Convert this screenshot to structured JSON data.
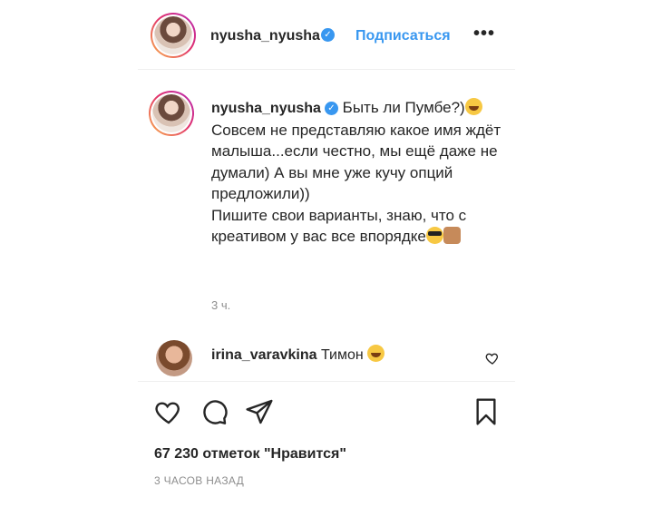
{
  "header": {
    "username": "nyusha_nyusha",
    "verified_mark": "✓",
    "follow_label": "Подписаться",
    "more_label": "•••"
  },
  "caption": {
    "username": "nyusha_nyusha",
    "verified_mark": "✓",
    "line1": "Быть ли Пумбе?)",
    "line2": "Совсем не представляю какое имя ждёт малыша...если честно, мы ещё даже не думали) А вы мне уже кучу опций предложили))",
    "line3": "Пишите свои варианты, знаю, что с креативом у вас все впорядке",
    "time": "3 ч."
  },
  "comment": {
    "username": "irina_varavkina",
    "text": "Тимон"
  },
  "footer": {
    "likes": "67 230 отметок \"Нравится\"",
    "ago": "3 ЧАСОВ НАЗАД"
  },
  "icons": [
    "heart-icon",
    "comment-icon",
    "share-icon",
    "bookmark-icon",
    "more-icon",
    "verified-badge-icon"
  ],
  "colors": {
    "link": "#3897f0",
    "text": "#262626",
    "muted": "#8e8e8e",
    "border": "#efefef"
  }
}
